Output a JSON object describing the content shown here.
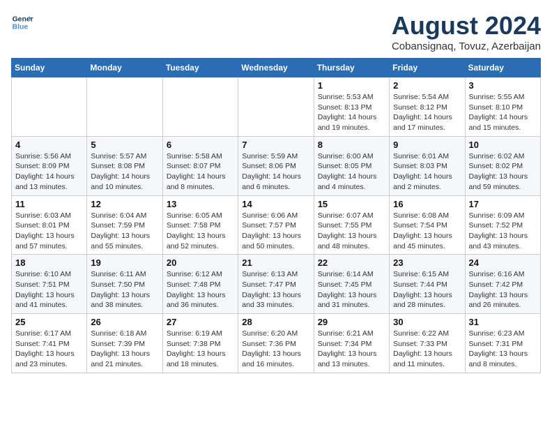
{
  "logo": {
    "line1": "General",
    "line2": "Blue"
  },
  "title": "August 2024",
  "subtitle": "Cobansignaq, Tovuz, Azerbaijan",
  "days_header": [
    "Sunday",
    "Monday",
    "Tuesday",
    "Wednesday",
    "Thursday",
    "Friday",
    "Saturday"
  ],
  "weeks": [
    [
      {
        "day": "",
        "info": ""
      },
      {
        "day": "",
        "info": ""
      },
      {
        "day": "",
        "info": ""
      },
      {
        "day": "",
        "info": ""
      },
      {
        "day": "1",
        "info": "Sunrise: 5:53 AM\nSunset: 8:13 PM\nDaylight: 14 hours\nand 19 minutes."
      },
      {
        "day": "2",
        "info": "Sunrise: 5:54 AM\nSunset: 8:12 PM\nDaylight: 14 hours\nand 17 minutes."
      },
      {
        "day": "3",
        "info": "Sunrise: 5:55 AM\nSunset: 8:10 PM\nDaylight: 14 hours\nand 15 minutes."
      }
    ],
    [
      {
        "day": "4",
        "info": "Sunrise: 5:56 AM\nSunset: 8:09 PM\nDaylight: 14 hours\nand 13 minutes."
      },
      {
        "day": "5",
        "info": "Sunrise: 5:57 AM\nSunset: 8:08 PM\nDaylight: 14 hours\nand 10 minutes."
      },
      {
        "day": "6",
        "info": "Sunrise: 5:58 AM\nSunset: 8:07 PM\nDaylight: 14 hours\nand 8 minutes."
      },
      {
        "day": "7",
        "info": "Sunrise: 5:59 AM\nSunset: 8:06 PM\nDaylight: 14 hours\nand 6 minutes."
      },
      {
        "day": "8",
        "info": "Sunrise: 6:00 AM\nSunset: 8:05 PM\nDaylight: 14 hours\nand 4 minutes."
      },
      {
        "day": "9",
        "info": "Sunrise: 6:01 AM\nSunset: 8:03 PM\nDaylight: 14 hours\nand 2 minutes."
      },
      {
        "day": "10",
        "info": "Sunrise: 6:02 AM\nSunset: 8:02 PM\nDaylight: 13 hours\nand 59 minutes."
      }
    ],
    [
      {
        "day": "11",
        "info": "Sunrise: 6:03 AM\nSunset: 8:01 PM\nDaylight: 13 hours\nand 57 minutes."
      },
      {
        "day": "12",
        "info": "Sunrise: 6:04 AM\nSunset: 7:59 PM\nDaylight: 13 hours\nand 55 minutes."
      },
      {
        "day": "13",
        "info": "Sunrise: 6:05 AM\nSunset: 7:58 PM\nDaylight: 13 hours\nand 52 minutes."
      },
      {
        "day": "14",
        "info": "Sunrise: 6:06 AM\nSunset: 7:57 PM\nDaylight: 13 hours\nand 50 minutes."
      },
      {
        "day": "15",
        "info": "Sunrise: 6:07 AM\nSunset: 7:55 PM\nDaylight: 13 hours\nand 48 minutes."
      },
      {
        "day": "16",
        "info": "Sunrise: 6:08 AM\nSunset: 7:54 PM\nDaylight: 13 hours\nand 45 minutes."
      },
      {
        "day": "17",
        "info": "Sunrise: 6:09 AM\nSunset: 7:52 PM\nDaylight: 13 hours\nand 43 minutes."
      }
    ],
    [
      {
        "day": "18",
        "info": "Sunrise: 6:10 AM\nSunset: 7:51 PM\nDaylight: 13 hours\nand 41 minutes."
      },
      {
        "day": "19",
        "info": "Sunrise: 6:11 AM\nSunset: 7:50 PM\nDaylight: 13 hours\nand 38 minutes."
      },
      {
        "day": "20",
        "info": "Sunrise: 6:12 AM\nSunset: 7:48 PM\nDaylight: 13 hours\nand 36 minutes."
      },
      {
        "day": "21",
        "info": "Sunrise: 6:13 AM\nSunset: 7:47 PM\nDaylight: 13 hours\nand 33 minutes."
      },
      {
        "day": "22",
        "info": "Sunrise: 6:14 AM\nSunset: 7:45 PM\nDaylight: 13 hours\nand 31 minutes."
      },
      {
        "day": "23",
        "info": "Sunrise: 6:15 AM\nSunset: 7:44 PM\nDaylight: 13 hours\nand 28 minutes."
      },
      {
        "day": "24",
        "info": "Sunrise: 6:16 AM\nSunset: 7:42 PM\nDaylight: 13 hours\nand 26 minutes."
      }
    ],
    [
      {
        "day": "25",
        "info": "Sunrise: 6:17 AM\nSunset: 7:41 PM\nDaylight: 13 hours\nand 23 minutes."
      },
      {
        "day": "26",
        "info": "Sunrise: 6:18 AM\nSunset: 7:39 PM\nDaylight: 13 hours\nand 21 minutes."
      },
      {
        "day": "27",
        "info": "Sunrise: 6:19 AM\nSunset: 7:38 PM\nDaylight: 13 hours\nand 18 minutes."
      },
      {
        "day": "28",
        "info": "Sunrise: 6:20 AM\nSunset: 7:36 PM\nDaylight: 13 hours\nand 16 minutes."
      },
      {
        "day": "29",
        "info": "Sunrise: 6:21 AM\nSunset: 7:34 PM\nDaylight: 13 hours\nand 13 minutes."
      },
      {
        "day": "30",
        "info": "Sunrise: 6:22 AM\nSunset: 7:33 PM\nDaylight: 13 hours\nand 11 minutes."
      },
      {
        "day": "31",
        "info": "Sunrise: 6:23 AM\nSunset: 7:31 PM\nDaylight: 13 hours\nand 8 minutes."
      }
    ]
  ]
}
